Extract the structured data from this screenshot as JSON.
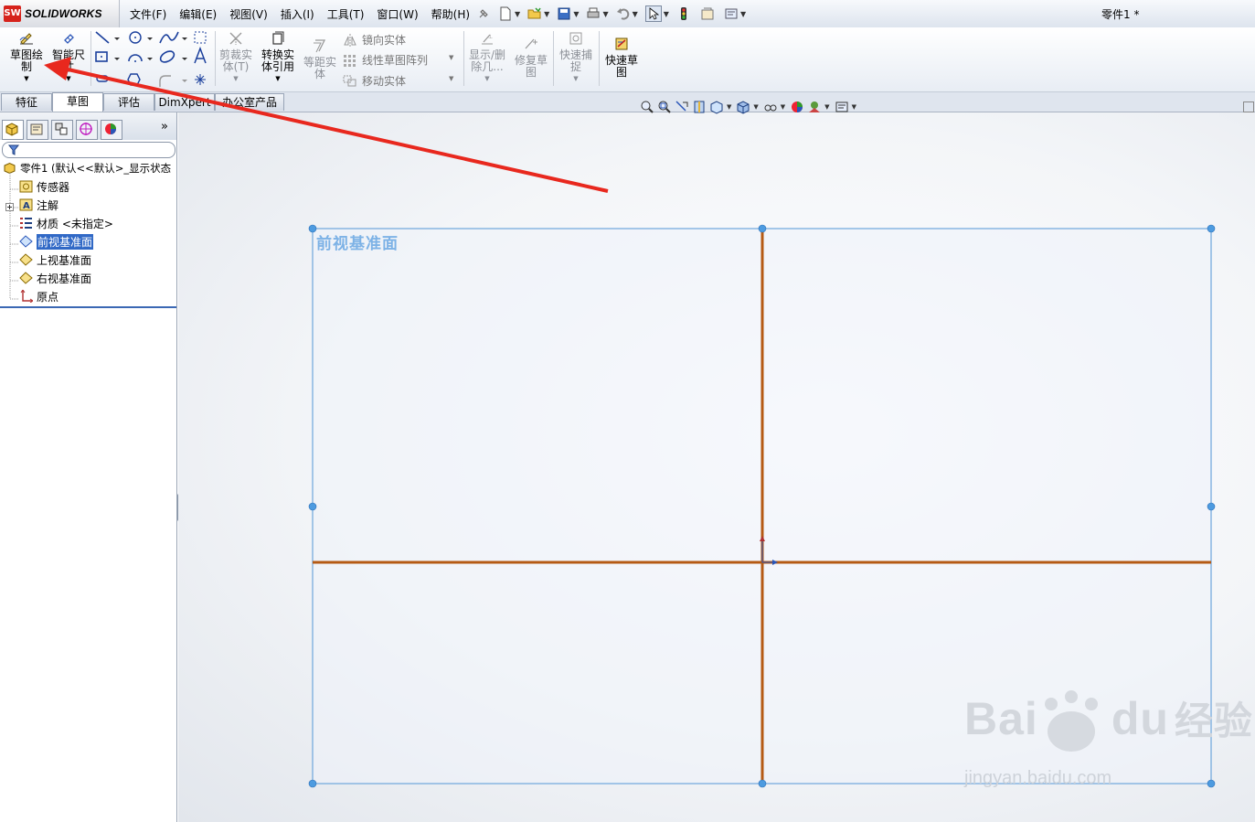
{
  "app": {
    "logo_letters": "SW",
    "logo_text": "SOLIDWORKS",
    "doc_title": "零件1 *"
  },
  "menu": [
    "文件(F)",
    "编辑(E)",
    "视图(V)",
    "插入(I)",
    "工具(T)",
    "窗口(W)",
    "帮助(H)"
  ],
  "commands": {
    "sketch": "草图绘\n制",
    "smart_dim": "智能尺\n寸",
    "trim": "剪裁实\n体(T)",
    "convert": "转换实\n体引用",
    "offset": "等距实\n体",
    "mirror": "镜向实体",
    "linear_pattern": "线性草图阵列",
    "move": "移动实体",
    "show_delete": "显示/删\n除几...",
    "repair": "修复草\n图",
    "quick_snap": "快速捕\n捉",
    "rapid_sketch": "快速草\n图"
  },
  "tabs": [
    "特征",
    "草图",
    "评估",
    "DimXpert",
    "办公室产品"
  ],
  "active_tab": "草图",
  "tree": {
    "root": "零件1  (默认<<默认>_显示状态",
    "items": [
      "传感器",
      "注解",
      "材质 <未指定>",
      "前视基准面",
      "上视基准面",
      "右视基准面",
      "原点"
    ],
    "selected": "前视基准面"
  },
  "view": {
    "plane_label": "前视基准面"
  },
  "watermark": {
    "brand": "Bai",
    "paw": "du",
    "cn": "经验",
    "url": "jingyan.baidu.com"
  },
  "colors": {
    "accent": "#3169c6",
    "sketch_line": "#b55a14",
    "plane_border": "#6ea6dc",
    "arrow": "#e8281e"
  }
}
